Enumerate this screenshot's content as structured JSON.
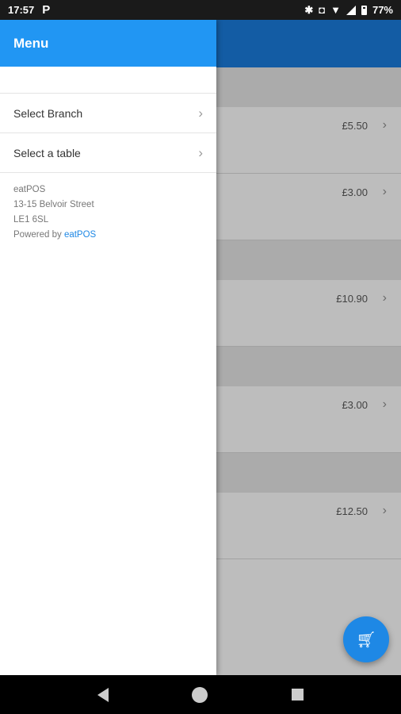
{
  "status_bar": {
    "time": "17:57",
    "p_glyph": "P",
    "battery_percent": "77%",
    "icons": [
      "parking-icon",
      "bluetooth-icon",
      "vibrate-icon",
      "wifi-icon",
      "signal-icon",
      "battery-icon"
    ]
  },
  "drawer": {
    "title": "Menu",
    "items": [
      {
        "label": "Select Branch"
      },
      {
        "label": "Select a table"
      }
    ],
    "info": {
      "name": "eatPOS",
      "address1": "13-15 Belvoir Street",
      "address2": "LE1 6SL",
      "powered_prefix": "Powered by ",
      "powered_link": "eatPOS"
    }
  },
  "background_items": [
    {
      "price": "£5.50"
    },
    {
      "price": "£3.00"
    },
    {
      "price": "£10.90"
    },
    {
      "price": "£3.00"
    },
    {
      "price": "£12.50"
    }
  ],
  "fab": {
    "icon": "cart-icon"
  },
  "colors": {
    "drawer_header": "#2196f3",
    "app_bar": "#1976d2",
    "fab": "#1e88e5",
    "link": "#1e88e5"
  }
}
